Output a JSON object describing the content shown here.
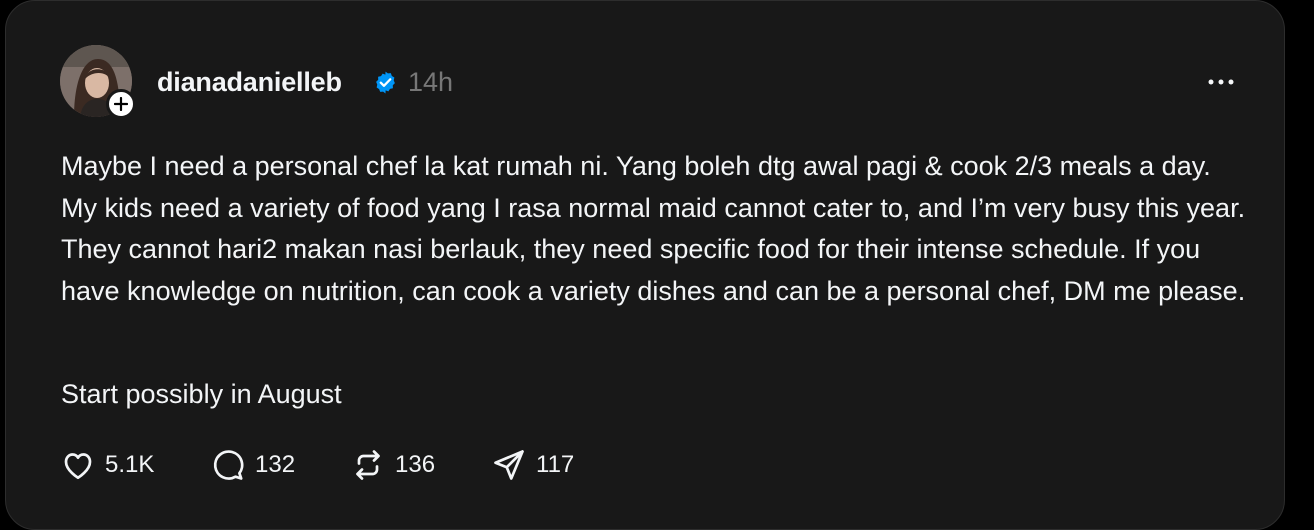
{
  "post": {
    "username": "dianadanielleb",
    "verified_icon": "verified-badge-icon",
    "time": "14h",
    "more_icon": "more-dots-icon",
    "avatar_follow_icon": "plus-icon",
    "text_paragraph1": "Maybe I need a personal chef la kat rumah ni. Yang boleh dtg awal pagi & cook 2/3 meals a day. My kids need a variety of food yang I rasa normal maid cannot cater to, and I’m very busy this year. They cannot hari2 makan nasi berlauk, they need specific food for their intense schedule. If you have knowledge on nutrition, can cook a variety dishes and can be a personal chef, DM me please.",
    "text_paragraph2": "Start possibly in August"
  },
  "actions": {
    "likes": "5.1K",
    "comments": "132",
    "reposts": "136",
    "shares": "117"
  },
  "colors": {
    "background": "#181818",
    "text": "#f3f5f7",
    "muted": "#777777",
    "verified": "#0095f6"
  }
}
